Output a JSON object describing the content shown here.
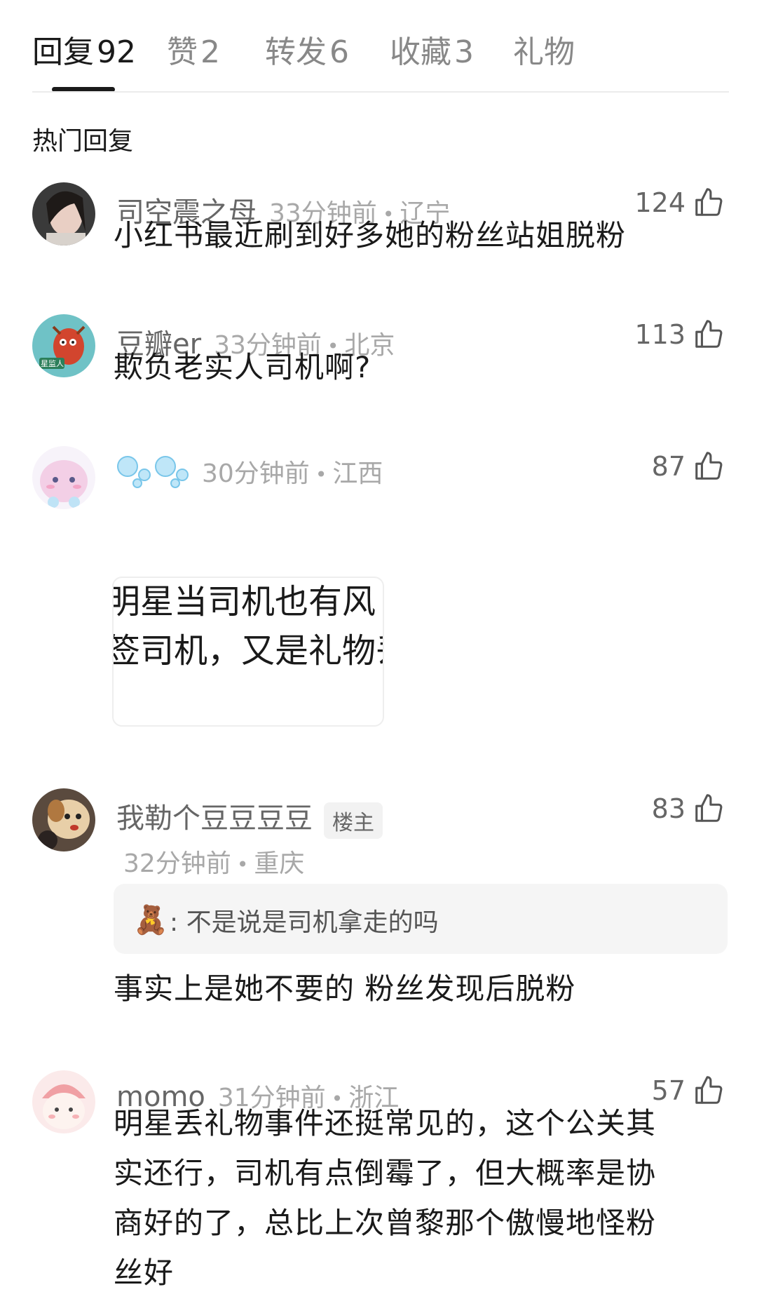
{
  "tabs": [
    {
      "label": "回复",
      "count": "92"
    },
    {
      "label": "赞",
      "count": "2"
    },
    {
      "label": "转发",
      "count": "6"
    },
    {
      "label": "收藏",
      "count": "3"
    },
    {
      "label": "礼物",
      "count": ""
    }
  ],
  "section_title": "热门回复",
  "comments": [
    {
      "name": "司空震之母",
      "time": "33分钟前",
      "location": "辽宁",
      "likes": "124",
      "text": "小红书最近刷到好多她的粉丝站姐脱粉"
    },
    {
      "name": "豆瓣er",
      "time": "33分钟前",
      "location": "北京",
      "likes": "113",
      "text": "欺负老实人司机啊?",
      "avatar_text": "星监人"
    },
    {
      "name": "",
      "time": "30分钟前",
      "location": "江西",
      "likes": "87",
      "image_lines": [
        "明星当司机也有风",
        "签司机，又是礼物丢"
      ]
    },
    {
      "name": "我勒个豆豆豆豆",
      "badge": "楼主",
      "time": "32分钟前",
      "location": "重庆",
      "likes": "83",
      "quote": ": 不是说是司机拿走的吗",
      "text": "事实上是她不要的 粉丝发现后脱粉"
    },
    {
      "name": "momo",
      "time": "31分钟前",
      "location": "浙江",
      "likes": "57",
      "lines": [
        "明星丢礼物事件还挺常见的，这个公关其",
        "实还行，司机有点倒霉了，但大概率是协",
        "商好的了，总比上次曾黎那个傲慢地怪粉",
        "丝好"
      ]
    }
  ],
  "colors": {
    "text": "#1a1a1a",
    "secondary": "#666666",
    "muted": "#a8a8a8",
    "bubble": "#a6dbf2"
  }
}
